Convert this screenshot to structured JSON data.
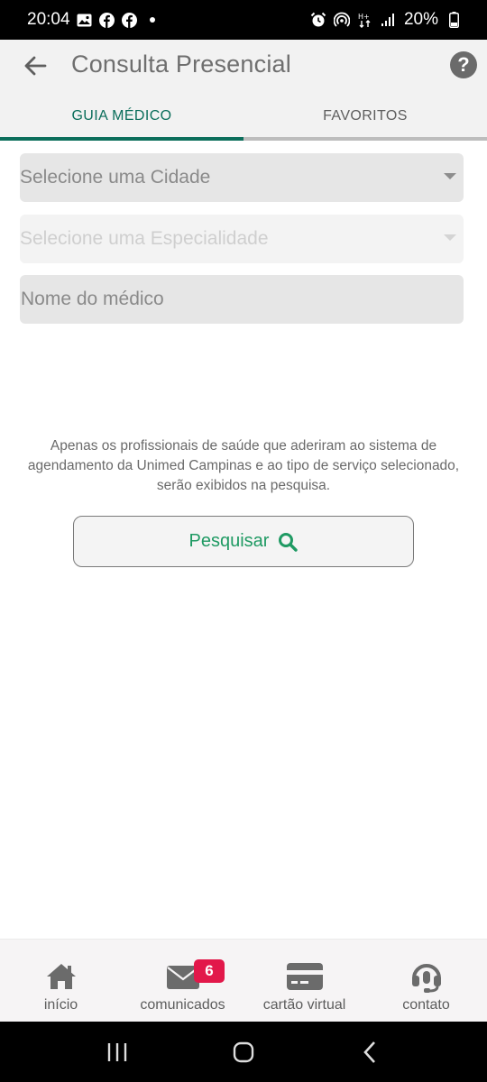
{
  "status_bar": {
    "time": "20:04",
    "battery": "20%",
    "left_icons": [
      "gallery-icon",
      "facebook-icon",
      "facebook-icon",
      "dot-icon"
    ],
    "right_icons": [
      "alarm-icon",
      "hotspot-icon",
      "data-arrows-icon",
      "signal-icon",
      "battery-icon"
    ]
  },
  "header": {
    "title": "Consulta Presencial",
    "back_icon": "arrow-left-icon",
    "help_icon": "help-icon",
    "help_label": "?"
  },
  "tabs": [
    {
      "label": "GUIA MÉDICO",
      "active": true
    },
    {
      "label": "FAVORITOS",
      "active": false
    }
  ],
  "form": {
    "city_placeholder": "Selecione uma Cidade",
    "specialty_placeholder": "Selecione uma Especialidade",
    "doctor_name_placeholder": "Nome do médico",
    "doctor_name_value": ""
  },
  "info_text": "Apenas os profissionais de saúde que aderiram ao sistema de agendamento da Unimed Campinas e ao tipo de serviço selecionado, serão exibidos na pesquisa.",
  "search_button": {
    "label": "Pesquisar",
    "icon": "search-icon"
  },
  "bottom_nav": [
    {
      "label": "início",
      "icon": "home-icon"
    },
    {
      "label": "comunicados",
      "icon": "mail-icon",
      "badge": "6"
    },
    {
      "label": "cartão virtual",
      "icon": "card-icon"
    },
    {
      "label": "contato",
      "icon": "headset-icon"
    }
  ],
  "colors": {
    "accent": "#0b6e5b",
    "search_green": "#1f9a63",
    "badge": "#e2184a"
  }
}
